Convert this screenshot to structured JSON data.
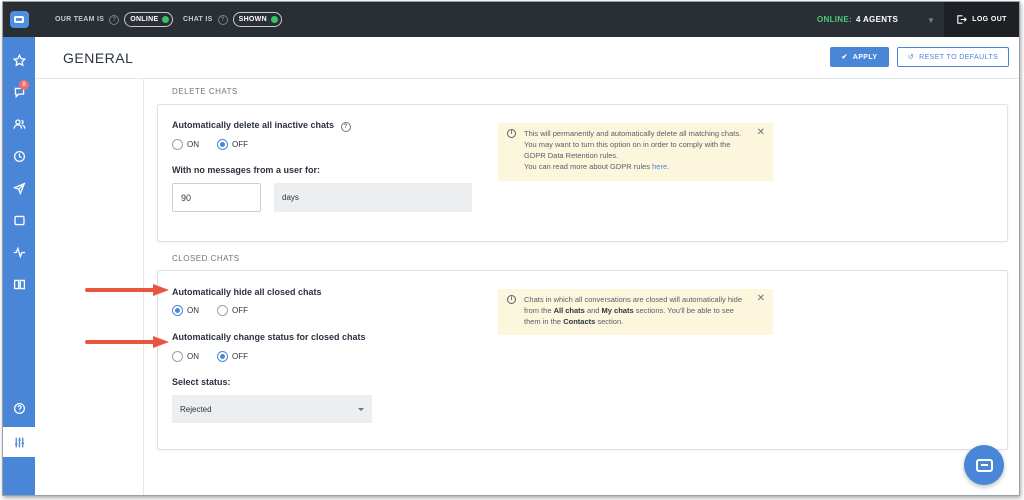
{
  "topbar": {
    "team_label": "OUR TEAM IS",
    "team_status": "ONLINE",
    "chat_label": "CHAT IS",
    "chat_status": "SHOWN",
    "online_label": "ONLINE:",
    "agents_label": "4 AGENTS",
    "logout_label": "LOG OUT"
  },
  "sidebar": {
    "items": [
      {
        "icon": "star-icon"
      },
      {
        "icon": "chats-icon",
        "badge": "8"
      },
      {
        "icon": "customers-icon"
      },
      {
        "icon": "history-icon"
      },
      {
        "icon": "send-icon"
      },
      {
        "icon": "archive-icon"
      },
      {
        "icon": "reports-icon"
      },
      {
        "icon": "book-icon"
      },
      {
        "icon": "help-icon"
      },
      {
        "icon": "settings-icon"
      }
    ]
  },
  "header": {
    "title": "GENERAL",
    "apply_label": "APPLY",
    "reset_label": "RESET TO DEFAULTS"
  },
  "delete_chats": {
    "section_title": "DELETE CHATS",
    "setting_label": "Automatically delete all inactive chats",
    "on_label": "ON",
    "off_label": "OFF",
    "selected": "OFF",
    "no_messages_label": "With no messages from a user for:",
    "days_value": "90",
    "days_unit": "days",
    "info_text": "This will permanently and automatically delete all matching chats. You may want to turn this option on in order to comply with the GDPR Data Retention rules.",
    "info_text2": "You can read more about GDPR rules ",
    "info_link": "here",
    "info_tail": "."
  },
  "closed_chats": {
    "section_title": "CLOSED CHATS",
    "hide_label": "Automatically hide all closed chats",
    "hide_selected": "ON",
    "change_status_label": "Automatically change status for closed chats",
    "change_status_selected": "OFF",
    "on_label": "ON",
    "off_label": "OFF",
    "select_status_label": "Select status:",
    "status_value": "Rejected",
    "info_part1": "Chats in which all conversations are closed will automatically hide from the ",
    "info_bold1": "All chats",
    "info_part2": " and ",
    "info_bold2": "My chats",
    "info_part3": " sections. You'll be able to see them in the ",
    "info_bold3": "Contacts",
    "info_part4": " section."
  },
  "colors": {
    "accent": "#4a86d7",
    "topbar": "#2a2f35",
    "online_green": "#4cc77b",
    "annotation_arrow": "#e8553f",
    "info_background": "#fcf6dc"
  }
}
